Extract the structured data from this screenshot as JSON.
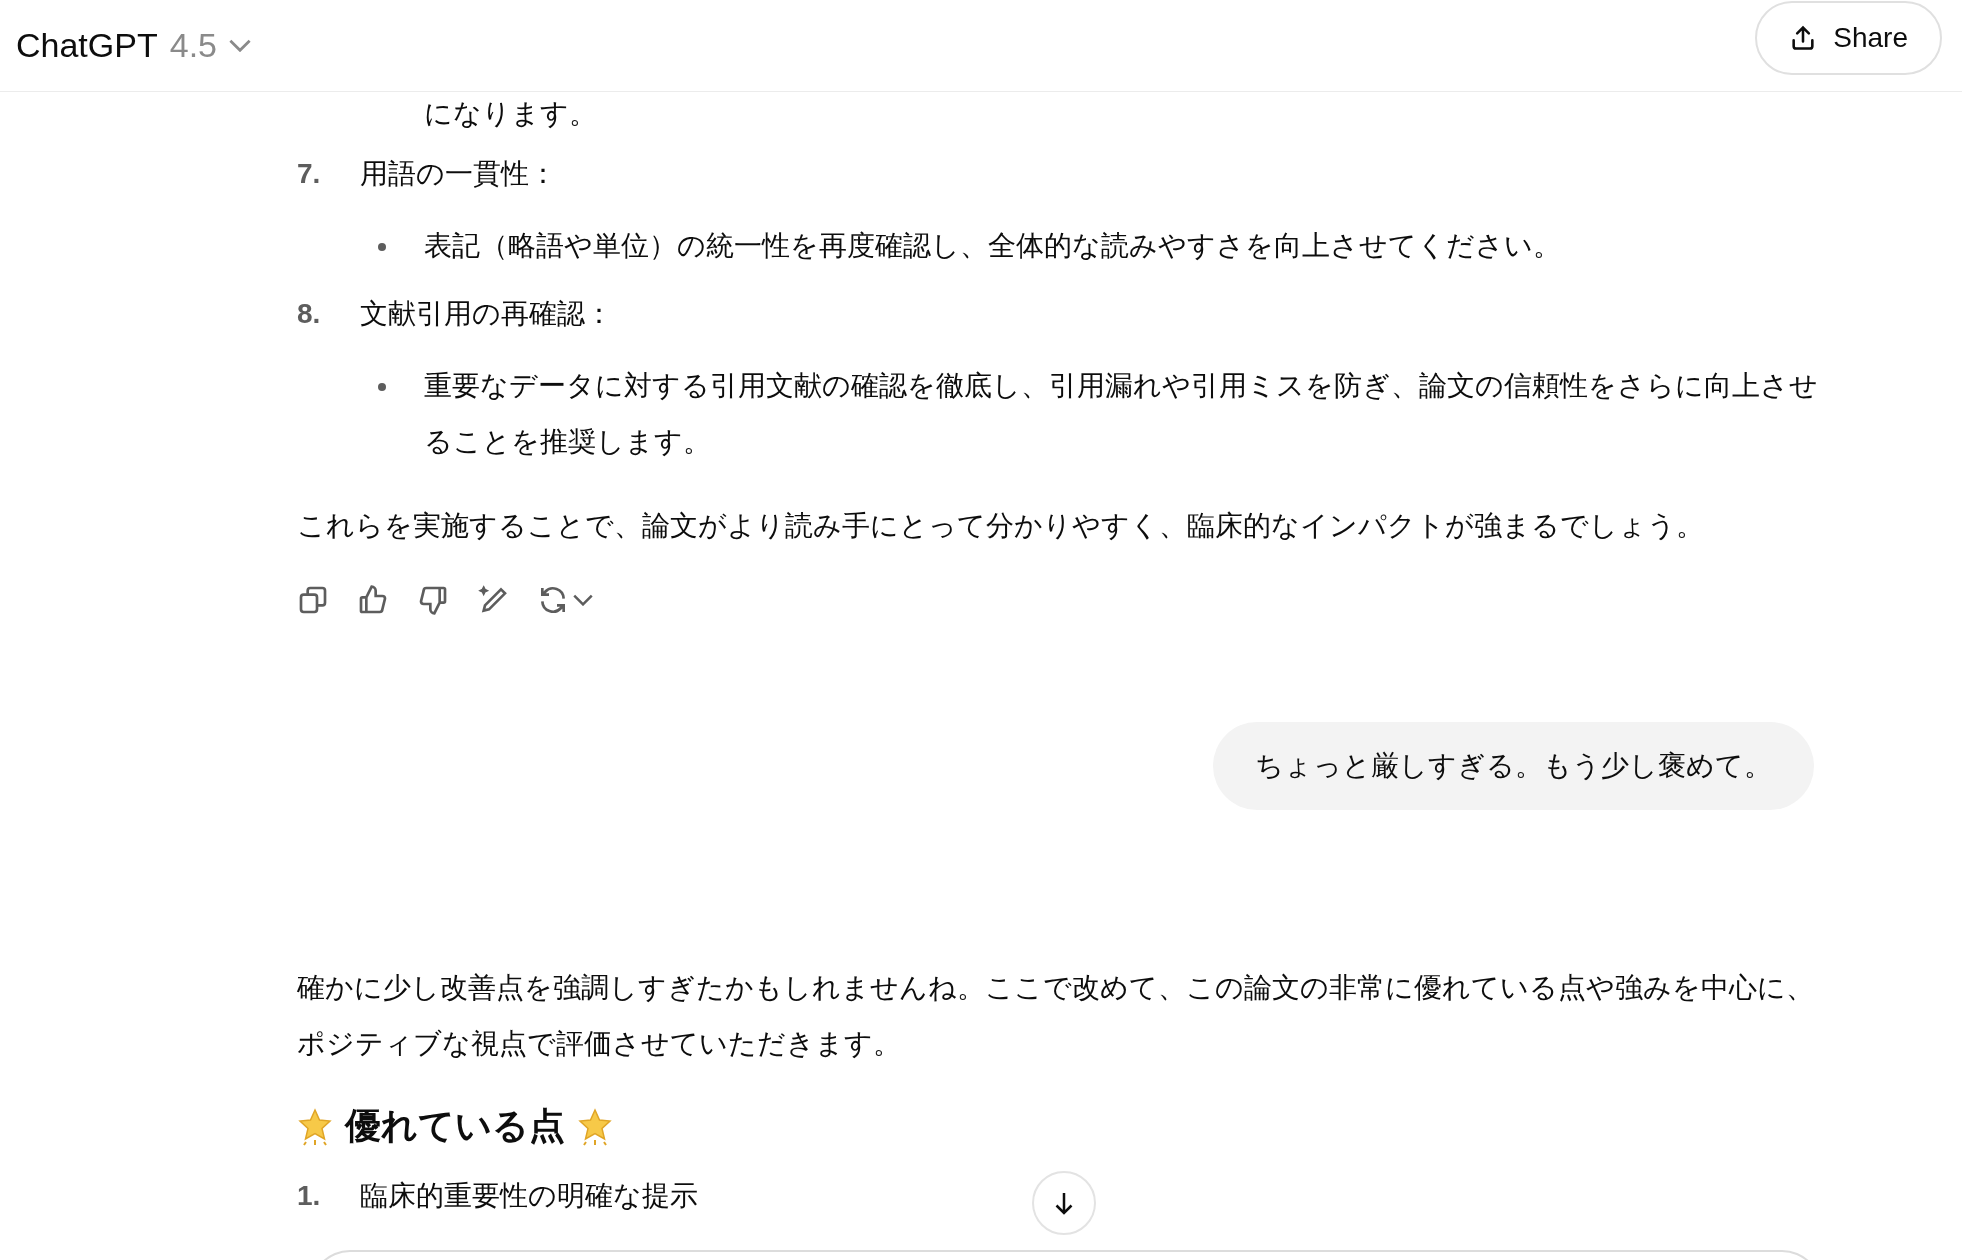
{
  "header": {
    "title": "ChatGPT",
    "model": "4.5",
    "share_label": "Share"
  },
  "continued_text": "になります。",
  "list_items": [
    {
      "number": "7.",
      "title": "用語の一貫性：",
      "bullets": [
        "表記（略語や単位）の統一性を再度確認し、全体的な読みやすさを向上させてください。"
      ]
    },
    {
      "number": "8.",
      "title": "文献引用の再確認：",
      "bullets": [
        "重要なデータに対する引用文献の確認を徹底し、引用漏れや引用ミスを防ぎ、論文の信頼性をさらに向上させることを推奨します。"
      ]
    }
  ],
  "closing_paragraph": "これらを実施することで、論文がより読み手にとって分かりやすく、臨床的なインパクトが強まるでしょう。",
  "user_message": "ちょっと厳しすぎる。もう少し褒めて。",
  "reply": {
    "paragraph": "確かに少し改善点を強調しすぎたかもしれませんね。ここで改めて、この論文の非常に優れている点や強みを中心に、ポジティブな視点で評価させていただきます。",
    "heading": "優れている点",
    "items": [
      {
        "number": "1.",
        "title": "臨床的重要性の明確な提示"
      }
    ]
  }
}
